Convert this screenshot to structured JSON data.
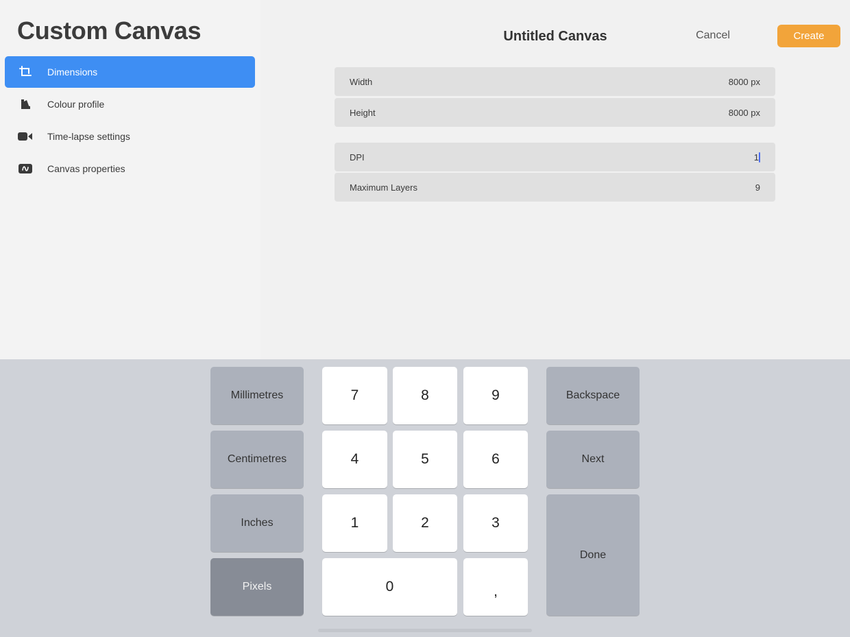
{
  "app_title": "Custom Canvas",
  "sidebar": {
    "items": [
      {
        "label": "Dimensions",
        "icon": "crop-dimensions-icon",
        "active": true
      },
      {
        "label": "Colour profile",
        "icon": "colour-swatch-icon",
        "active": false
      },
      {
        "label": "Time-lapse settings",
        "icon": "video-camera-icon",
        "active": false
      },
      {
        "label": "Canvas properties",
        "icon": "canvas-properties-icon",
        "active": false
      }
    ]
  },
  "header": {
    "title": "Untitled Canvas",
    "cancel_label": "Cancel",
    "create_label": "Create"
  },
  "fields": {
    "width": {
      "label": "Width",
      "value": "8000 px"
    },
    "height": {
      "label": "Height",
      "value": "8000 px"
    },
    "dpi": {
      "label": "DPI",
      "value": "1"
    },
    "max_layers": {
      "label": "Maximum Layers",
      "value": "9"
    }
  },
  "keyboard": {
    "units": [
      "Millimetres",
      "Centimetres",
      "Inches",
      "Pixels"
    ],
    "selected_unit": "Pixels",
    "digits": [
      "7",
      "8",
      "9",
      "4",
      "5",
      "6",
      "1",
      "2",
      "3",
      "0",
      ","
    ],
    "backspace_label": "Backspace",
    "next_label": "Next",
    "done_label": "Done"
  },
  "colors": {
    "accent_blue": "#3e8ef3",
    "create_orange": "#f2a43a",
    "caret_blue": "#4a6cf2",
    "keyboard_bg": "#cfd2d8"
  }
}
